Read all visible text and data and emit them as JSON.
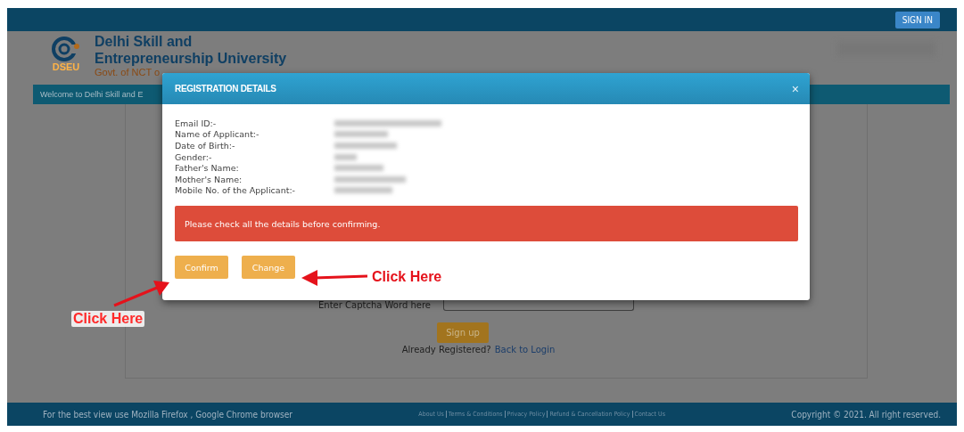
{
  "top_bar": {
    "sign_in_button": "SIGN IN"
  },
  "header": {
    "logo_text": "DSEU",
    "title_line_1": "Delhi Skill and",
    "title_line_2": "Entrepreneurship University",
    "subtitle": "Govt. of NCT o"
  },
  "welcome_bar": {
    "text": "Welcome to Delhi Skill and E"
  },
  "form": {
    "captcha_label": "Enter Captcha Word here",
    "signup_button": "Sign up",
    "already_registered": "Already Registered?",
    "back_to_login_link": "Back to Login"
  },
  "modal": {
    "title": "REGISTRATION DETAILS",
    "close": "×",
    "fields": [
      {
        "label": "Email ID:-"
      },
      {
        "label": "Name of Applicant:-"
      },
      {
        "label": "Date of Birth:-"
      },
      {
        "label": "Gender:-"
      },
      {
        "label": "Father's Name:"
      },
      {
        "label": "Mother's Name:"
      },
      {
        "label": "Mobile No. of the Applicant:-"
      }
    ],
    "alert": "Please check all the details before confirming.",
    "buttons": [
      "Confirm",
      "Change"
    ]
  },
  "annotations": [
    {
      "text": "Click Here",
      "kind": "right"
    },
    {
      "text": "Click Here",
      "kind": "below"
    }
  ],
  "footer": {
    "browser_note": "For the best view use Mozilla Firefox , Google Chrome browser",
    "links": [
      "About Us",
      "Terms & Conditions",
      "Privacy Policy",
      "Refund & Cancellation Policy",
      "Contact Us"
    ],
    "copyright": "Copyright © 2021. All right reserved."
  }
}
